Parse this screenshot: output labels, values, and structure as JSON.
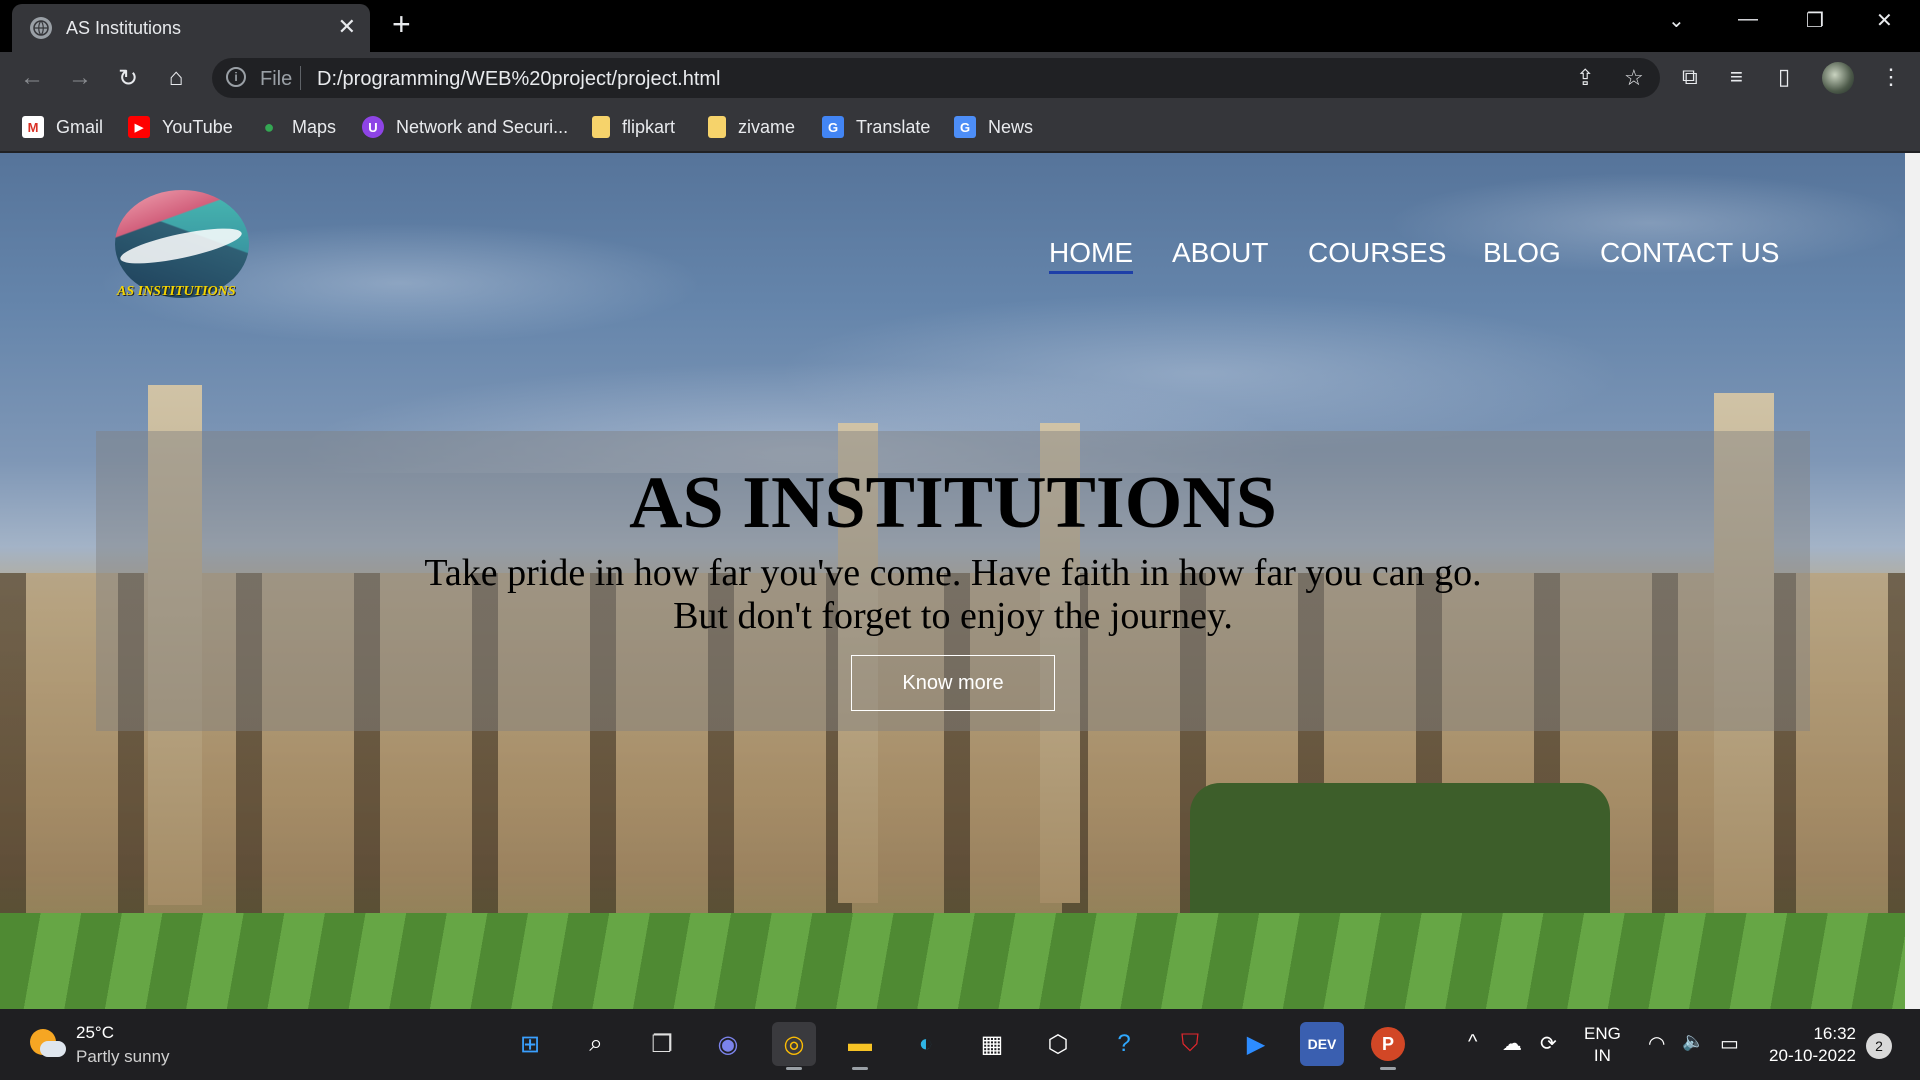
{
  "browser": {
    "tab": {
      "title": "AS Institutions",
      "favicon": "globe-icon",
      "close": "✕"
    },
    "new_tab": "+",
    "window_controls": {
      "dropdown": "⌄",
      "minimize": "—",
      "restore": "❐",
      "close": "✕"
    },
    "toolbar": {
      "back": "←",
      "forward": "→",
      "reload": "↻",
      "home": "⌂",
      "info": "i",
      "scheme": "File",
      "url": "D:/programming/WEB%20project/project.html",
      "share": "⇪",
      "star": "☆",
      "extensions": "⧉",
      "media": "≡",
      "sidepanel": "▯",
      "menu": "⋮"
    },
    "bookmarks": [
      {
        "label": "Gmail",
        "icon": "gmail-icon",
        "glyph": "M",
        "color": "#d93025"
      },
      {
        "label": "YouTube",
        "icon": "youtube-icon",
        "glyph": "▶",
        "color": "#ff0000"
      },
      {
        "label": "Maps",
        "icon": "maps-icon",
        "glyph": "●",
        "color": "#34a853"
      },
      {
        "label": "Network and Securi...",
        "icon": "network-icon",
        "glyph": "U",
        "color": "#8e44e6"
      },
      {
        "label": "flipkart",
        "icon": "folder-icon",
        "glyph": "",
        "color": "#f6d36b"
      },
      {
        "label": "zivame",
        "icon": "folder-icon",
        "glyph": "",
        "color": "#f6d36b"
      },
      {
        "label": "Translate",
        "icon": "translate-icon",
        "glyph": "G",
        "color": "#4285f4"
      },
      {
        "label": "News",
        "icon": "news-icon",
        "glyph": "G",
        "color": "#4d8ef7"
      }
    ]
  },
  "site": {
    "logo_text": "AS INSTITUTIONS",
    "nav": [
      {
        "label": "HOME",
        "active": true
      },
      {
        "label": "ABOUT",
        "active": false
      },
      {
        "label": "COURSES",
        "active": false
      },
      {
        "label": "BLOG",
        "active": false
      },
      {
        "label": "CONTACT US",
        "active": false
      }
    ],
    "hero": {
      "title": "AS INSTITUTIONS",
      "line1": "Take pride in how far you've come. Have faith in how far you can go.",
      "line2": "But don't forget to enjoy the journey.",
      "button": "Know more"
    }
  },
  "taskbar": {
    "weather": {
      "temp": "25°C",
      "desc": "Partly sunny"
    },
    "apps": [
      {
        "name": "start-icon",
        "glyph": "⊞",
        "color": "#3aa0ff"
      },
      {
        "name": "search-icon",
        "glyph": "⌕",
        "color": "#ffffff"
      },
      {
        "name": "task-view-icon",
        "glyph": "❐",
        "color": "#e0e0e0"
      },
      {
        "name": "teams-chat-icon",
        "glyph": "◉",
        "color": "#7b83eb"
      },
      {
        "name": "chrome-icon",
        "glyph": "◎",
        "color": "#fbbc05"
      },
      {
        "name": "file-explorer-icon",
        "glyph": "▬",
        "color": "#f7c325"
      },
      {
        "name": "edge-icon",
        "glyph": "◐",
        "color": "#2fb5e6"
      },
      {
        "name": "microsoft-store-icon",
        "glyph": "▦",
        "color": "#ffffff"
      },
      {
        "name": "app-icon",
        "glyph": "⬡",
        "color": "#ffffff"
      },
      {
        "name": "help-icon",
        "glyph": "?",
        "color": "#2fa8ff"
      },
      {
        "name": "mcafee-icon",
        "glyph": "⛉",
        "color": "#e4272d"
      },
      {
        "name": "zoom-icon",
        "glyph": "▶",
        "color": "#2d8cff"
      },
      {
        "name": "dev-cpp-icon",
        "glyph": "DEV",
        "color": "#3a5fb0"
      },
      {
        "name": "powerpoint-icon",
        "glyph": "P",
        "color": "#d24726"
      }
    ],
    "tray": {
      "chevron": "^",
      "cloud": "☁",
      "sync": "⟳",
      "wifi": "◠",
      "volume": "🔈",
      "battery": "▭"
    },
    "lang": {
      "line1": "ENG",
      "line2": "IN"
    },
    "clock": {
      "time": "16:32",
      "date": "20-10-2022"
    },
    "notifications": "2"
  }
}
